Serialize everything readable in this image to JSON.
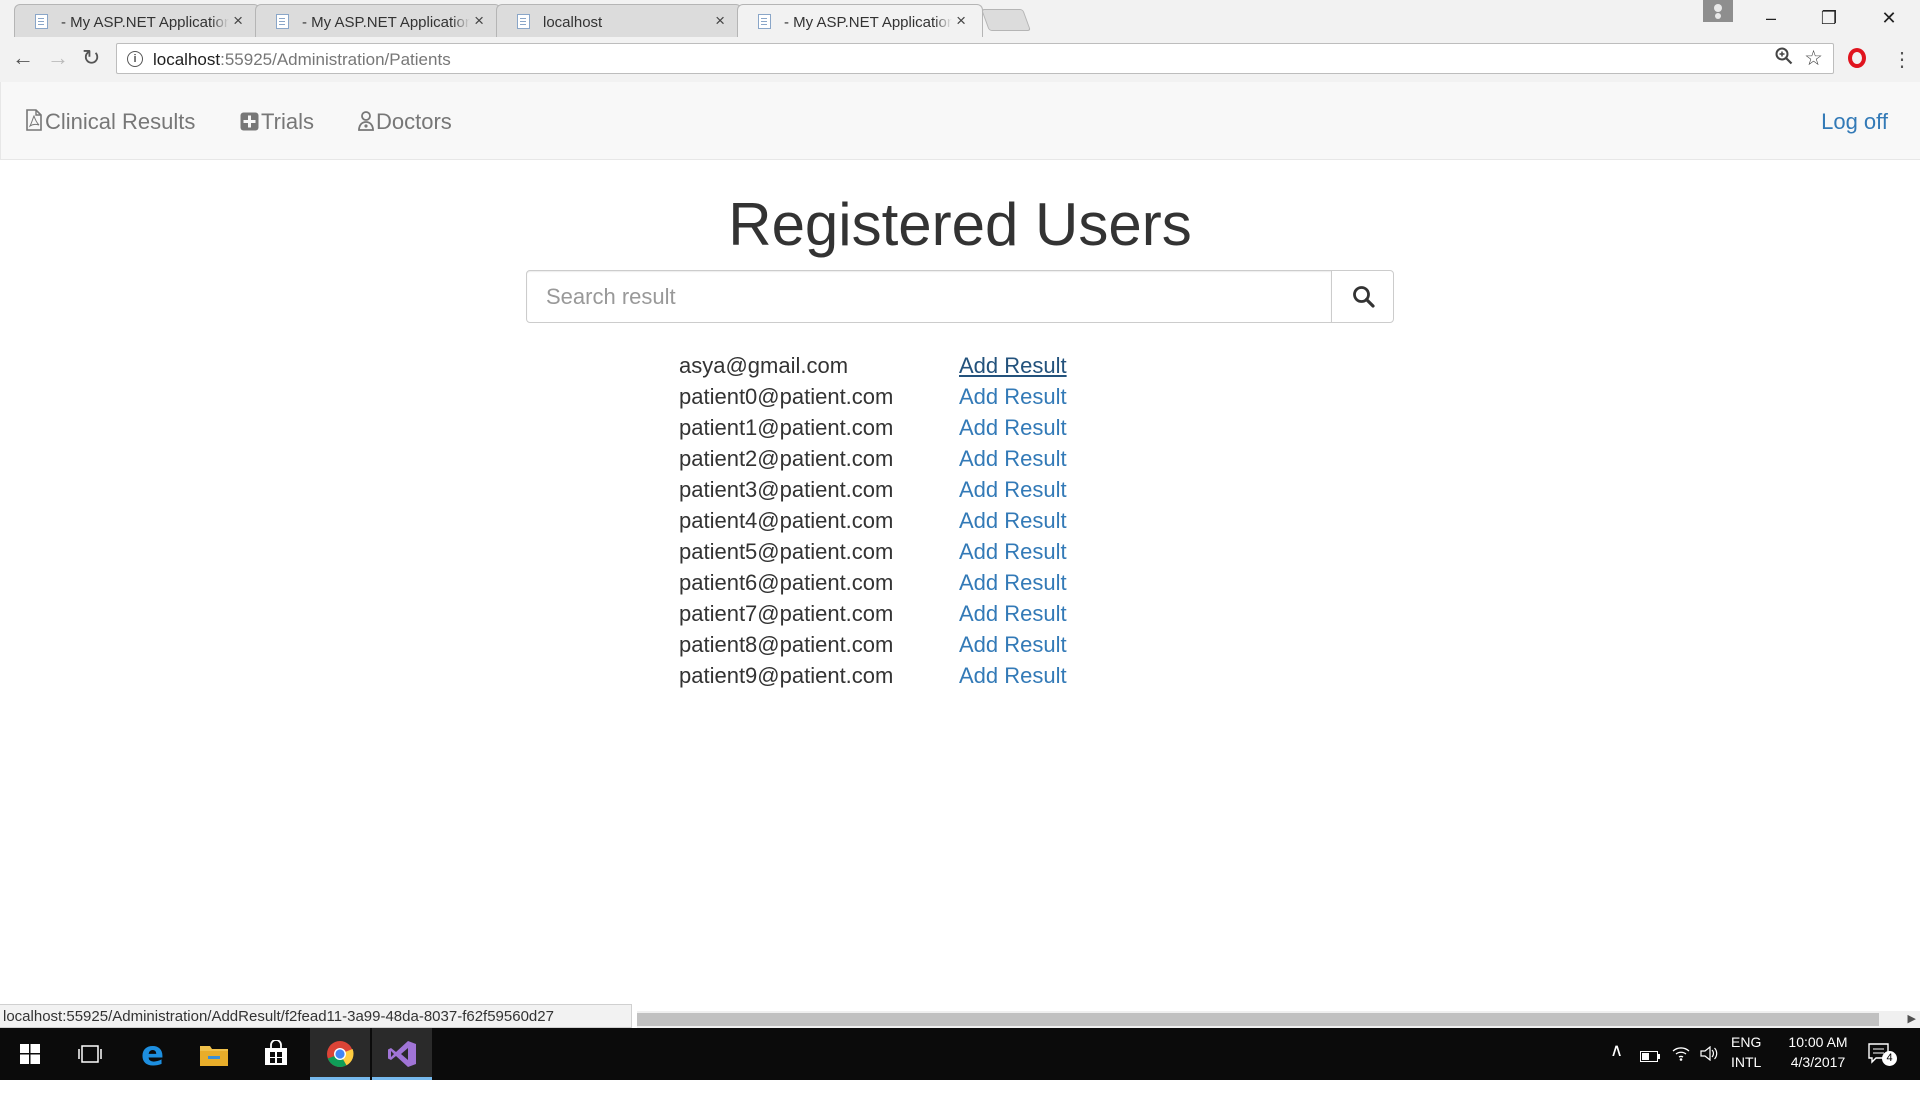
{
  "browser": {
    "tabs": [
      {
        "title": "- My ASP.NET Application",
        "active": false
      },
      {
        "title": "- My ASP.NET Application",
        "active": false
      },
      {
        "title": "localhost",
        "active": false
      },
      {
        "title": "- My ASP.NET Application",
        "active": true
      }
    ],
    "tab_close_glyph": "×",
    "url_host": "localhost",
    "url_rest": ":55925/Administration/Patients"
  },
  "sitenav": {
    "links": [
      {
        "label": "Clinical Results",
        "icon": "file-pdf-icon"
      },
      {
        "label": "Trials",
        "icon": "plus-square-icon"
      },
      {
        "label": "Doctors",
        "icon": "doctor-icon"
      }
    ],
    "logoff_label": "Log off"
  },
  "main": {
    "title": "Registered Users",
    "search_placeholder": "Search result",
    "search_icon": "search-icon",
    "users": [
      {
        "email": "asya@gmail.com",
        "action": "Add Result",
        "hover": true
      },
      {
        "email": "patient0@patient.com",
        "action": "Add Result"
      },
      {
        "email": "patient1@patient.com",
        "action": "Add Result"
      },
      {
        "email": "patient2@patient.com",
        "action": "Add Result"
      },
      {
        "email": "patient3@patient.com",
        "action": "Add Result"
      },
      {
        "email": "patient4@patient.com",
        "action": "Add Result"
      },
      {
        "email": "patient5@patient.com",
        "action": "Add Result"
      },
      {
        "email": "patient6@patient.com",
        "action": "Add Result"
      },
      {
        "email": "patient7@patient.com",
        "action": "Add Result"
      },
      {
        "email": "patient8@patient.com",
        "action": "Add Result"
      },
      {
        "email": "patient9@patient.com",
        "action": "Add Result"
      }
    ]
  },
  "status_url": "localhost:55925/Administration/AddResult/f2fead11-3a99-48da-8037-f62f59560d27",
  "taskbar": {
    "lang_top": "ENG",
    "lang_bottom": "INTL",
    "time": "10:00 AM",
    "date": "4/3/2017",
    "notification_count": "4"
  },
  "colors": {
    "link": "#337ab7",
    "link_hover": "#23527c",
    "navbar_bg": "#f8f8f8",
    "taskbar_bg": "#0b0b0b"
  }
}
